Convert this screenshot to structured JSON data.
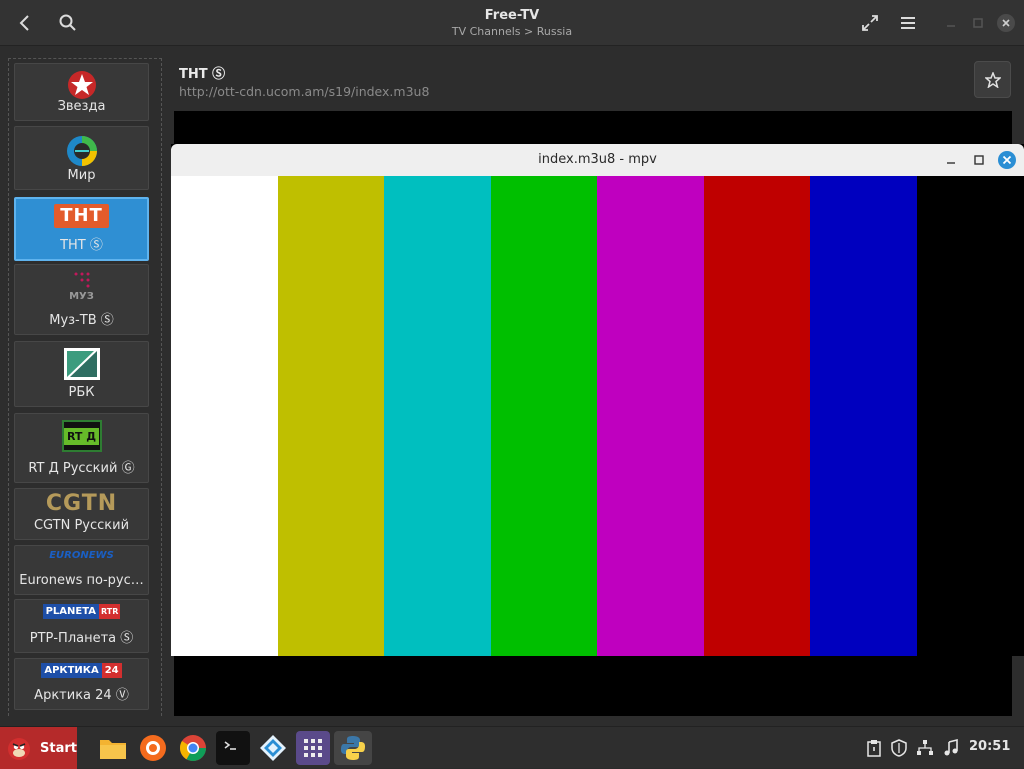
{
  "header": {
    "title": "Free-TV",
    "subtitle": "TV Channels > Russia"
  },
  "sidebar": {
    "items": [
      {
        "label": "Звезда",
        "logo": "star-logo"
      },
      {
        "label": "Мир",
        "logo": "mir-logo"
      },
      {
        "label": "ТНТ Ⓢ",
        "logo": "tnt-logo",
        "selected": true,
        "logo_text": "ТНТ"
      },
      {
        "label": "Муз-ТВ Ⓢ",
        "logo": "muz-logo",
        "logo_text": "МУЗ"
      },
      {
        "label": "РБК",
        "logo": "rbk-logo"
      },
      {
        "label": "RT Д Русский Ⓖ",
        "logo": "rtd-logo",
        "logo_text": "RT Д"
      },
      {
        "label": "CGTN Русский",
        "logo": "cgtn-logo",
        "logo_text": "CGTN"
      },
      {
        "label": "Euronews по-рус…",
        "logo": "euronews-logo",
        "logo_text": "EURONEWS"
      },
      {
        "label": "РТР-Планета Ⓢ",
        "logo": "planeta-logo",
        "logo_text": "PLANETA",
        "logo_text2": "RTR"
      },
      {
        "label": "Арктика 24 Ⓥ",
        "logo": "arktika-logo",
        "logo_text": "АРКТИКА",
        "logo_text2": "24"
      }
    ]
  },
  "content": {
    "title": "ТНТ Ⓢ",
    "url": "http://ott-cdn.ucom.am/s19/index.m3u8"
  },
  "mpv": {
    "title": "index.m3u8 - mpv",
    "bars": [
      "#ffffff",
      "#bfbf00",
      "#00bfbf",
      "#00bf00",
      "#bf00bf",
      "#bf0000",
      "#0000bf"
    ]
  },
  "taskbar": {
    "start_label": "Start",
    "clock": "20:51"
  },
  "colors": {
    "accent": "#2f8fd3",
    "start": "#b52a2a"
  }
}
